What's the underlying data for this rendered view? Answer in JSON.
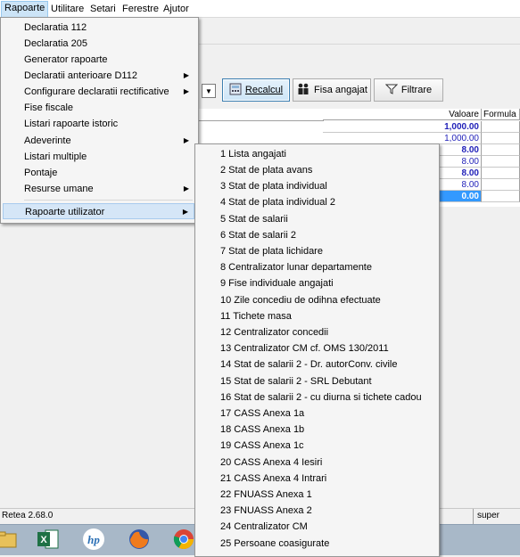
{
  "menubar": {
    "items": [
      "Rapoarte",
      "Utilitare",
      "Setari",
      "Ferestre",
      "Ajutor"
    ]
  },
  "toolbar": {
    "recalcul_label": "Recalcul",
    "fisa_angajat_label": "Fisa angajat",
    "filtrare_label": "Filtrare"
  },
  "grid": {
    "headers": [
      "Valoare",
      "Formula de"
    ],
    "values": [
      "1,000.00",
      "1,000.00",
      "8.00",
      "8.00",
      "8.00",
      "8.00",
      "0.00"
    ]
  },
  "rapoarte_menu": {
    "items": [
      {
        "label": "Declaratia 112",
        "submenu": false
      },
      {
        "label": "Declaratia 205",
        "submenu": false
      },
      {
        "label": "Generator rapoarte",
        "submenu": false
      },
      {
        "label": "Declaratii anterioare D112",
        "submenu": true
      },
      {
        "label": "Configurare declaratii rectificative",
        "submenu": true
      },
      {
        "label": "Fise fiscale",
        "submenu": false
      },
      {
        "label": "Listari rapoarte istoric",
        "submenu": false
      },
      {
        "label": "Adeverinte",
        "submenu": true
      },
      {
        "label": "Listari multiple",
        "submenu": false
      },
      {
        "label": "Pontaje",
        "submenu": false
      },
      {
        "label": "Resurse umane",
        "submenu": true
      },
      {
        "label": "Rapoarte utilizator",
        "submenu": true
      }
    ]
  },
  "rapoarte_utilizator_submenu": {
    "items": [
      "1 Lista angajati",
      "2 Stat de plata avans",
      "3 Stat de plata individual",
      "4 Stat de plata individual 2",
      "5 Stat de salarii",
      "6 Stat de salarii 2",
      "7 Stat de plata lichidare",
      "8 Centralizator lunar departamente",
      "9 Fise individuale angajati",
      "10 Zile concediu de odihna efectuate",
      "11 Tichete masa",
      "12 Centralizator concedii",
      "13 Centralizator CM cf. OMS 130/2011",
      "14 Stat de salarii 2 - Dr. autorConv. civile",
      "15 Stat de salarii 2 - SRL Debutant",
      "16 Stat de salarii 2 - cu diurna si tichete cadou",
      "17 CASS Anexa 1a",
      "18 CASS Anexa 1b",
      "19 CASS Anexa 1c",
      "20 CASS Anexa 4 Iesiri",
      "21 CASS Anexa 4 Intrari",
      "22 FNUASS Anexa 1",
      "23 FNUASS Anexa 2",
      "24 Centralizator CM",
      "25 Persoane coasigurate"
    ]
  },
  "statusbar": {
    "left": "Retea 2.68.0",
    "right": "super"
  },
  "taskbar": {
    "icons": [
      "file-explorer-icon",
      "excel-icon",
      "hp-icon",
      "firefox-icon",
      "chrome-icon"
    ]
  }
}
